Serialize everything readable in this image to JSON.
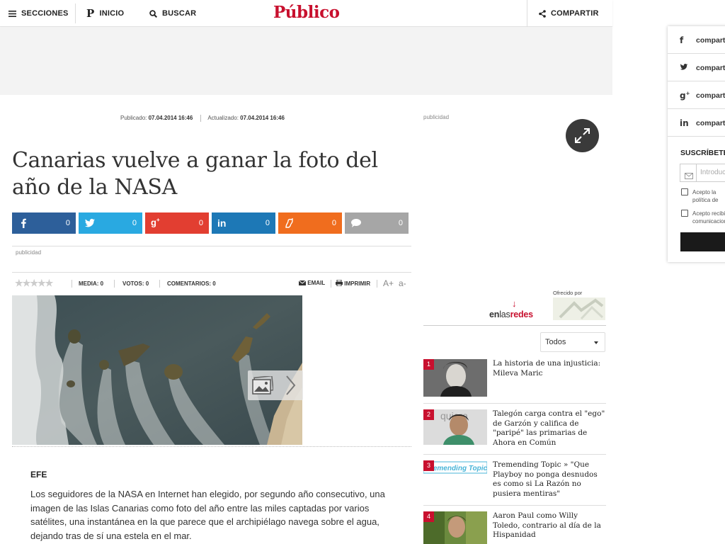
{
  "header": {
    "sections_label": "SECCIONES",
    "home_label": "INICIO",
    "search_label": "BUSCAR",
    "logo": "Público",
    "share_label": "COMPARTIR"
  },
  "article": {
    "published_label": "Publicado:",
    "published_date": "07.04.2014 16:46",
    "updated_label": "Actualizado:",
    "updated_date": "07.04.2014 16:46",
    "title": "Canarias vuelve a ganar la foto del año de la NASA",
    "ad_label": "publicidad",
    "source": "EFE",
    "body": "Los seguidores de la NASA en Internet han elegido, por segundo año consecutivo, una imagen de las Islas Canarias como foto del año entre las miles captadas por varios satélites, una instantánea en la que parece que el archipiélago navega sobre el agua, dejando tras de sí una estela en el mar."
  },
  "share_buttons": [
    {
      "network": "facebook",
      "icon": "facebook-icon",
      "count": "0",
      "color": "#2d5f9a"
    },
    {
      "network": "twitter",
      "icon": "twitter-icon",
      "count": "0",
      "color": "#29a9e1"
    },
    {
      "network": "googleplus",
      "icon": "googleplus-icon",
      "count": "0",
      "color": "#e23e31"
    },
    {
      "network": "linkedin",
      "icon": "linkedin-icon",
      "count": "0",
      "color": "#1d78b6"
    },
    {
      "network": "meneame",
      "icon": "meneame-icon",
      "count": "0",
      "color": "#f06d1e"
    },
    {
      "network": "comments",
      "icon": "comment-icon",
      "count": "0",
      "color": "#a6a6a6"
    }
  ],
  "toolbar": {
    "rating_value": 0,
    "rating_max": 5,
    "media": "MEDIA: 0",
    "votos": "VOTOS: 0",
    "comentarios": "COMENTARIOS: 0",
    "email": "EMAIL",
    "imprimir": "IMPRIMIR",
    "font_up": "A+",
    "font_down": "a-"
  },
  "sidebar": {
    "ad_label": "publicidad",
    "offered_by": "Ofrecido por",
    "enlasredes": {
      "part1": "en",
      "part2": "las",
      "part3": "redes"
    },
    "filter_value": "Todos",
    "trending": [
      {
        "num": "1",
        "title": "La historia de una injusticia: Mileva Maric"
      },
      {
        "num": "2",
        "title": "Talegón carga contra el \"ego\" de Garzón y califica de \"paripé\" las primarias de Ahora en Común"
      },
      {
        "num": "3",
        "title": "Tremending Topic » \"Que Playboy no ponga desnudos es como si La Razón no pusiera mentiras\""
      },
      {
        "num": "4",
        "title": "Aaron Paul como Willy Toledo, contrario al día de la Hispanidad"
      }
    ]
  },
  "side_share_panel": {
    "items": [
      {
        "icon": "facebook-icon",
        "label": "compartir"
      },
      {
        "icon": "twitter-icon",
        "label": "compartir"
      },
      {
        "icon": "googleplus-icon",
        "label": "compartir"
      },
      {
        "icon": "linkedin-icon",
        "label": "compartir"
      }
    ],
    "subscribe_title": "SUSCRÍBETE",
    "email_placeholder": "Introduce tu email",
    "check1": "Acepto la política de privacidad y el tratamiento de datos.",
    "check1_link": "datos.",
    "check2": "Acepto recibir comunicaciones comerciales"
  }
}
